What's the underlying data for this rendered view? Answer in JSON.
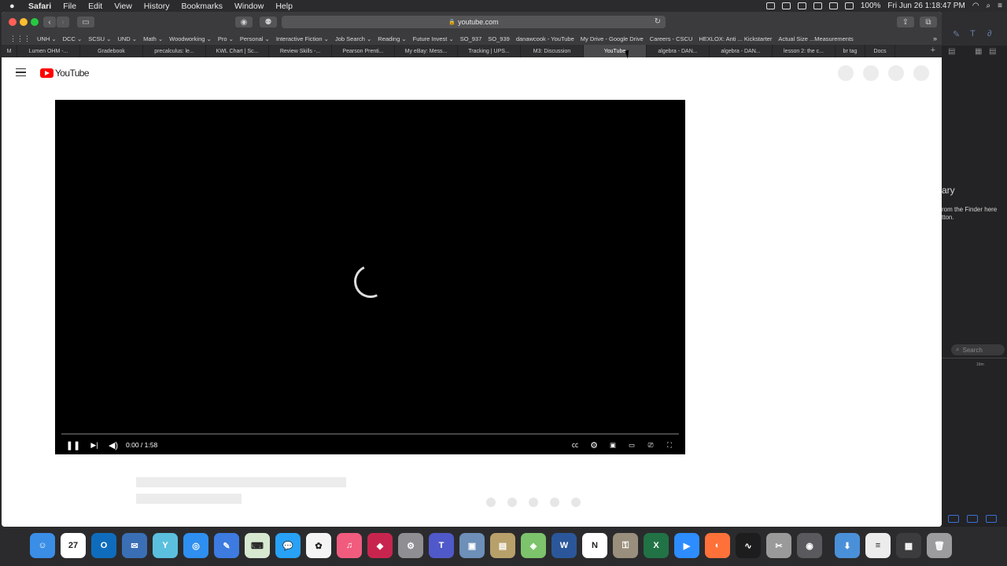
{
  "menubar": {
    "app": "Safari",
    "items": [
      "File",
      "Edit",
      "View",
      "History",
      "Bookmarks",
      "Window",
      "Help"
    ],
    "clock": "Fri Jun 26  1:18:47 PM",
    "battery": "100%"
  },
  "toolbar": {
    "url": "youtube.com",
    "lock": "🔒"
  },
  "bookmarks": [
    "UNH ⌄",
    "DCC ⌄",
    "SCSU ⌄",
    "UND ⌄",
    "Math ⌄",
    "Woodworking ⌄",
    "Pro ⌄",
    "Personal ⌄",
    "Interactive Fiction ⌄",
    "Job Search ⌄",
    "Reading ⌄",
    "Future Invest ⌄",
    "SO_937",
    "SO_939",
    "danawcook - YouTube",
    "My Drive - Google Drive",
    "Careers - CSCU",
    "HEXLOX: Anti ... Kickstarter",
    "Actual Size ...Measurements"
  ],
  "tabs": [
    "M",
    "Lumen OHM -...",
    "Gradebook",
    "precalculus: le...",
    "KWL Chart | Sc...",
    "Review Skills -...",
    "Pearson Prenti...",
    "My eBay: Mess...",
    "Tracking | UPS...",
    "M3: Discussion",
    "YouTube",
    "algebra - DAN...",
    "algebra - DAN...",
    "lesson 2: the c...",
    "br tag",
    "Docs"
  ],
  "active_tab_index": 10,
  "youtube": {
    "logo_text": "YouTube",
    "time": "0:00 / 1:58"
  },
  "right_panel": {
    "title": "ary",
    "hint_line1": "rom the Finder here",
    "hint_line2": "tton.",
    "search_placeholder": "Search",
    "size": "16m"
  },
  "dock": [
    {
      "name": "Finder",
      "color": "#3a8ee6",
      "glyph": "☺"
    },
    {
      "name": "Calendar",
      "color": "#ffffff",
      "glyph": "27"
    },
    {
      "name": "Outlook",
      "color": "#0f6cbd",
      "glyph": "O"
    },
    {
      "name": "Mail Bird",
      "color": "#3a6fb5",
      "glyph": "✉"
    },
    {
      "name": "Yep",
      "color": "#5bc0de",
      "glyph": "Y"
    },
    {
      "name": "Safari",
      "color": "#2e8ff0",
      "glyph": "◎"
    },
    {
      "name": "Pencil",
      "color": "#3d7be0",
      "glyph": "✎"
    },
    {
      "name": "Keyboard",
      "color": "#d7e8d0",
      "glyph": "⌨"
    },
    {
      "name": "Messages",
      "color": "#27a2f6",
      "glyph": "💬"
    },
    {
      "name": "Photos",
      "color": "#f4f4f4",
      "glyph": "✿"
    },
    {
      "name": "Music",
      "color": "#f15c7e",
      "glyph": "♫"
    },
    {
      "name": "Affinity",
      "color": "#c8254e",
      "glyph": "◆"
    },
    {
      "name": "System Preferences",
      "color": "#8e8e93",
      "glyph": "⚙"
    },
    {
      "name": "Teams",
      "color": "#5059c9",
      "glyph": "T"
    },
    {
      "name": "Preview",
      "color": "#6d8fb8",
      "glyph": "▣"
    },
    {
      "name": "Archive",
      "color": "#b8a06a",
      "glyph": "▤"
    },
    {
      "name": "Maps",
      "color": "#7cc36b",
      "glyph": "◈"
    },
    {
      "name": "Word",
      "color": "#2b579a",
      "glyph": "W"
    },
    {
      "name": "Notion",
      "color": "#ffffff",
      "glyph": "N"
    },
    {
      "name": "Keychain",
      "color": "#9a8f7c",
      "glyph": "⚿"
    },
    {
      "name": "Excel",
      "color": "#217346",
      "glyph": "X"
    },
    {
      "name": "Zoom",
      "color": "#2d8cff",
      "glyph": "▶"
    },
    {
      "name": "Firefox",
      "color": "#ff7139",
      "glyph": "◐"
    },
    {
      "name": "Activity Monitor",
      "color": "#1d1d1d",
      "glyph": "∿"
    },
    {
      "name": "Script Editor",
      "color": "#9a9a9a",
      "glyph": "✂"
    },
    {
      "name": "Logic",
      "color": "#5a5a5e",
      "glyph": "◉"
    },
    {
      "name": "Downloads",
      "color": "#4a90d9",
      "glyph": "⬇"
    },
    {
      "name": "Document",
      "color": "#ececec",
      "glyph": "≡"
    },
    {
      "name": "Screens",
      "color": "#3c3c3e",
      "glyph": "▦"
    },
    {
      "name": "Trash",
      "color": "#9c9c9e",
      "glyph": "🗑"
    }
  ]
}
